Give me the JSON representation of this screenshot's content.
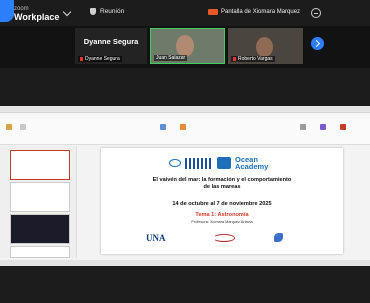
{
  "app": {
    "logo_line1": "zoom",
    "logo_line2": "Workplace"
  },
  "meeting": {
    "title": "Reunión"
  },
  "share": {
    "label": "Pantalla de Xiomara Marquez"
  },
  "gallery": {
    "main_name": "Dyanne Segura",
    "tiles": [
      {
        "name": "Dyanne Segura"
      },
      {
        "name": "Juan Salazar"
      },
      {
        "name": "Roberto Vargas"
      }
    ]
  },
  "slide": {
    "brand_line1": "Ocean",
    "brand_line2": "Academy",
    "title_line1": "El vaivén del mar: la formación y el comportamiento",
    "title_line2": "de las mareas",
    "dates": "14 de octubre al 7 de noviembre 2025",
    "topic": "Tema 1: Astronomía",
    "professor": "Profesora: Xiomara Márquez Artavia",
    "university": "UNA"
  },
  "colors": {
    "accent": "#2d7ff9",
    "active_speaker": "#3fcf5a",
    "topic_red": "#d43a2c",
    "brand_blue": "#1d6fb8"
  }
}
